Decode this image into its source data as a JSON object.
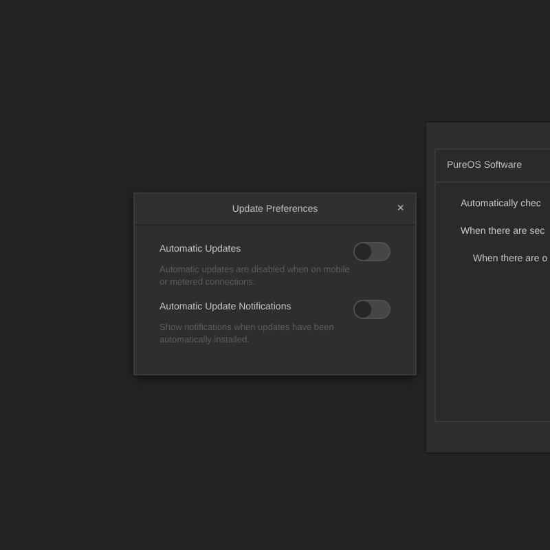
{
  "dialog": {
    "title": "Update Preferences",
    "close": "×",
    "settings": [
      {
        "label": "Automatic Updates",
        "description": "Automatic updates are disabled when on mobile or metered connections.",
        "on": false
      },
      {
        "label": "Automatic Update Notifications",
        "description": "Show notifications when updates have been automatically installed.",
        "on": false
      }
    ]
  },
  "background_window": {
    "tab": "PureOS Software",
    "lines": [
      "Automatically chec",
      "When there are sec",
      "When there are o"
    ]
  }
}
